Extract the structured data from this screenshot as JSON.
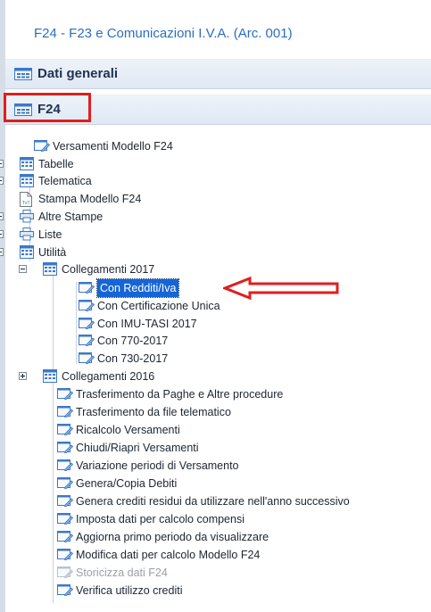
{
  "header": {
    "title": "F24 - F23 e Comunicazioni I.V.A.  (Arc. 001)"
  },
  "panels": [
    {
      "label": "Dati generali",
      "icon": "grid-icon"
    },
    {
      "label": "F24",
      "icon": "grid-icon"
    }
  ],
  "tree": [
    {
      "label": "Versamenti Modello F24",
      "icon": "form-icon",
      "toggle": "",
      "selected": false,
      "disabled": false
    },
    {
      "label": "Tabelle",
      "icon": "table-icon",
      "toggle": "plus",
      "selected": false,
      "disabled": false
    },
    {
      "label": "Telematica",
      "icon": "table-icon",
      "toggle": "plus",
      "selected": false,
      "disabled": false
    },
    {
      "label": "Stampa Modello F24",
      "icon": "txt-file-icon",
      "toggle": "",
      "selected": false,
      "disabled": false
    },
    {
      "label": "Altre Stampe",
      "icon": "printer-icon",
      "toggle": "plus",
      "selected": false,
      "disabled": false
    },
    {
      "label": "Liste",
      "icon": "printer-icon",
      "toggle": "plus",
      "selected": false,
      "disabled": false
    },
    {
      "label": "Utilità",
      "icon": "table-icon",
      "toggle": "minus",
      "selected": false,
      "disabled": false
    },
    {
      "label": "Collegamenti 2017",
      "icon": "table-icon",
      "toggle": "minus",
      "selected": false,
      "disabled": false
    },
    {
      "label": "Con Redditi/Iva",
      "icon": "form-icon",
      "toggle": "",
      "selected": true,
      "disabled": false
    },
    {
      "label": "Con Certificazione Unica",
      "icon": "form-icon",
      "toggle": "",
      "selected": false,
      "disabled": false
    },
    {
      "label": "Con IMU-TASI 2017",
      "icon": "form-icon",
      "toggle": "",
      "selected": false,
      "disabled": false
    },
    {
      "label": "Con 770-2017",
      "icon": "form-icon",
      "toggle": "",
      "selected": false,
      "disabled": false
    },
    {
      "label": "Con 730-2017",
      "icon": "form-icon",
      "toggle": "",
      "selected": false,
      "disabled": false
    },
    {
      "label": "Collegamenti 2016",
      "icon": "table-icon",
      "toggle": "plus",
      "selected": false,
      "disabled": false
    },
    {
      "label": "Trasferimento da Paghe e Altre procedure",
      "icon": "form-icon",
      "toggle": "",
      "selected": false,
      "disabled": false
    },
    {
      "label": "Trasferimento da file telematico",
      "icon": "form-icon",
      "toggle": "",
      "selected": false,
      "disabled": false
    },
    {
      "label": "Ricalcolo Versamenti",
      "icon": "form-icon",
      "toggle": "",
      "selected": false,
      "disabled": false
    },
    {
      "label": "Chiudi/Riapri Versamenti",
      "icon": "form-icon",
      "toggle": "",
      "selected": false,
      "disabled": false
    },
    {
      "label": "Variazione periodi di Versamento",
      "icon": "form-icon",
      "toggle": "",
      "selected": false,
      "disabled": false
    },
    {
      "label": "Genera/Copia Debiti",
      "icon": "form-icon",
      "toggle": "",
      "selected": false,
      "disabled": false
    },
    {
      "label": "Genera crediti residui da utilizzare nell'anno successivo",
      "icon": "form-icon",
      "toggle": "",
      "selected": false,
      "disabled": false
    },
    {
      "label": "Imposta dati per calcolo compensi",
      "icon": "form-icon",
      "toggle": "",
      "selected": false,
      "disabled": false
    },
    {
      "label": "Aggiorna primo periodo da visualizzare",
      "icon": "form-icon",
      "toggle": "",
      "selected": false,
      "disabled": false
    },
    {
      "label": "Modifica dati per calcolo Modello F24",
      "icon": "form-icon",
      "toggle": "",
      "selected": false,
      "disabled": false
    },
    {
      "label": "Storicizza dati F24",
      "icon": "form-icon",
      "toggle": "",
      "selected": false,
      "disabled": true
    },
    {
      "label": "Verifica utilizzo crediti",
      "icon": "form-icon",
      "toggle": "",
      "selected": false,
      "disabled": false
    }
  ],
  "colors": {
    "title": "#2c6ec1",
    "highlight_box": "#e01e1e",
    "selection": "#1565d8"
  }
}
